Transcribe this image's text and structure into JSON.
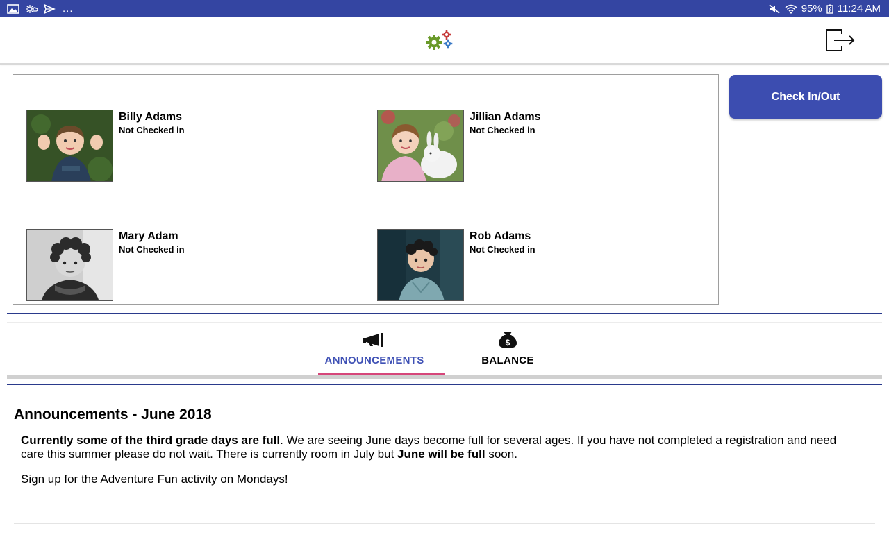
{
  "status_bar": {
    "left_icons": [
      "image-icon",
      "weather-icon",
      "send-icon"
    ],
    "overflow": "...",
    "right_icons": [
      "mute-icon",
      "wifi-icon"
    ],
    "battery": "95%",
    "time": "11:24 AM"
  },
  "header": {
    "logo_icon": "gears-logo-icon",
    "logout_icon": "logout-icon"
  },
  "children": [
    {
      "name": "Billy Adams",
      "status": "Not Checked in"
    },
    {
      "name": "Jillian Adams",
      "status": "Not Checked in"
    },
    {
      "name": "Mary Adam",
      "status": "Not Checked in"
    },
    {
      "name": "Rob Adams",
      "status": "Not Checked in"
    }
  ],
  "actions": {
    "check_in_out": "Check In/Out"
  },
  "tabs": [
    {
      "label": "ANNOUNCEMENTS",
      "icon": "megaphone-icon",
      "active": true
    },
    {
      "label": "BALANCE",
      "icon": "money-bag-icon",
      "active": false
    }
  ],
  "announcements": {
    "title": "Announcements - June 2018",
    "p1_bold1": "Currently some of the third grade days are full",
    "p1_text1": ". We are seeing June days become full for several ages. If you have not completed a registration and need care this summer please do not wait. There is currently room in July but ",
    "p1_bold2": "June will be full",
    "p1_text2": " soon.",
    "p2": "Sign up for the Adventure Fun activity on Mondays!"
  },
  "colors": {
    "status_bar": "#3445a2",
    "primary": "#3c4db0",
    "active_tab_text": "#3f51b5",
    "tab_indicator": "#d6467a"
  }
}
